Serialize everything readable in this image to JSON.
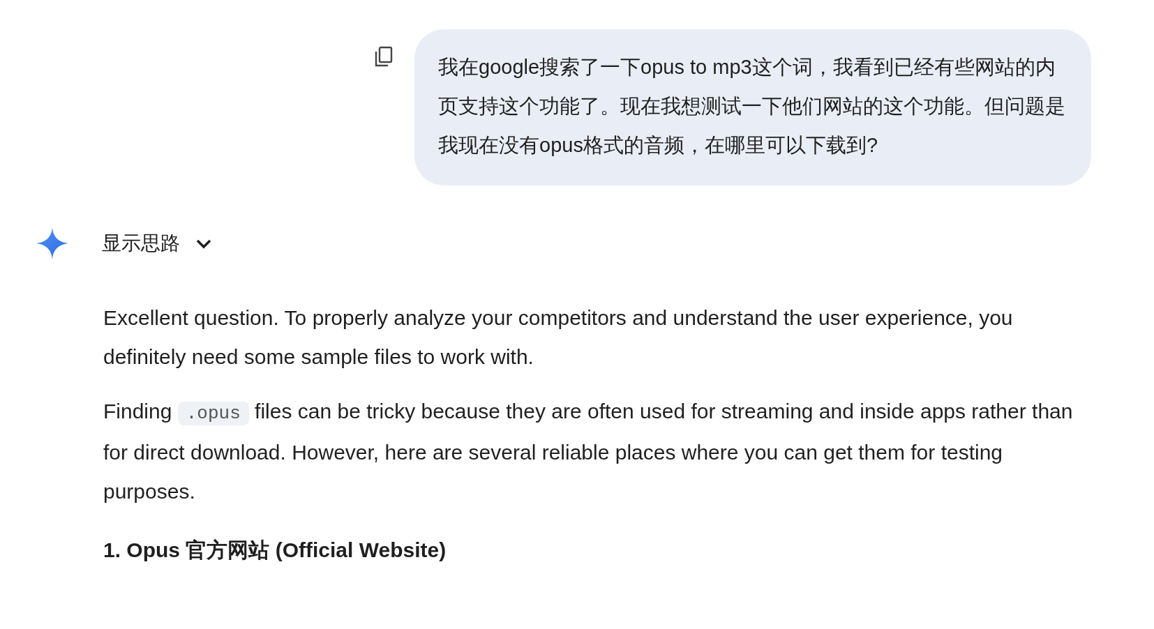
{
  "user_message": {
    "text": "我在google搜索了一下opus to mp3这个词，我看到已经有些网站的内页支持这个功能了。现在我想测试一下他们网站的这个功能。但问题是我现在没有opus格式的音频，在哪里可以下载到?"
  },
  "response": {
    "thinking_toggle": {
      "label": "显示思路",
      "expanded": false
    },
    "paragraphs": [
      {
        "parts": [
          {
            "kind": "text",
            "text": "Excellent question. To properly analyze your competitors and understand the user experience, you definitely need some sample files to work with."
          }
        ]
      },
      {
        "parts": [
          {
            "kind": "text",
            "text": "Finding "
          },
          {
            "kind": "code",
            "text": ".opus"
          },
          {
            "kind": "text",
            "text": " files can be tricky because they are often used for streaming and inside apps rather than for direct download. However, here are several reliable places where you can get them for testing purposes."
          }
        ]
      }
    ],
    "heading": "1. Opus 官方网站 (Official Website)"
  }
}
